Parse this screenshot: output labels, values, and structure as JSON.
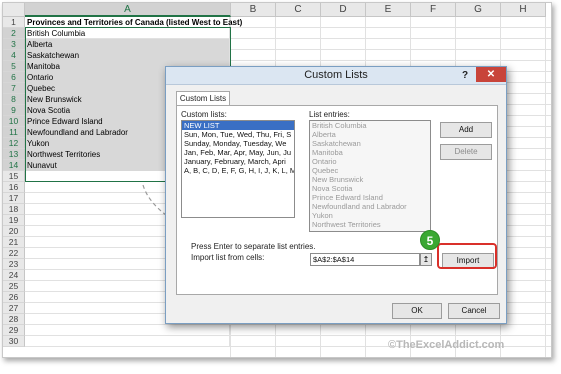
{
  "sheet": {
    "columns": [
      "A",
      "B",
      "C",
      "D",
      "E",
      "F",
      "G",
      "H"
    ],
    "rows": [
      {
        "num": "1",
        "a": "Provinces and Territories of Canada (listed West to East)"
      },
      {
        "num": "2",
        "a": "British Columbia"
      },
      {
        "num": "3",
        "a": "Alberta"
      },
      {
        "num": "4",
        "a": "Saskatchewan"
      },
      {
        "num": "5",
        "a": "Manitoba"
      },
      {
        "num": "6",
        "a": "Ontario"
      },
      {
        "num": "7",
        "a": "Quebec"
      },
      {
        "num": "8",
        "a": "New Brunswick"
      },
      {
        "num": "9",
        "a": "Nova Scotia"
      },
      {
        "num": "10",
        "a": "Prince Edward Island"
      },
      {
        "num": "11",
        "a": "Newfoundland and Labrador"
      },
      {
        "num": "12",
        "a": "Yukon"
      },
      {
        "num": "13",
        "a": "Northwest Territories"
      },
      {
        "num": "14",
        "a": "Nunavut"
      },
      {
        "num": "15",
        "a": ""
      },
      {
        "num": "16",
        "a": ""
      },
      {
        "num": "17",
        "a": ""
      },
      {
        "num": "18",
        "a": ""
      },
      {
        "num": "19",
        "a": ""
      },
      {
        "num": "20",
        "a": ""
      },
      {
        "num": "21",
        "a": ""
      },
      {
        "num": "22",
        "a": ""
      },
      {
        "num": "23",
        "a": ""
      },
      {
        "num": "24",
        "a": ""
      },
      {
        "num": "25",
        "a": ""
      },
      {
        "num": "26",
        "a": ""
      },
      {
        "num": "27",
        "a": ""
      },
      {
        "num": "28",
        "a": ""
      },
      {
        "num": "29",
        "a": ""
      },
      {
        "num": "30",
        "a": ""
      }
    ]
  },
  "dialog": {
    "title": "Custom Lists",
    "help": "?",
    "close": "✕",
    "tab": "Custom Lists",
    "custom_lists_label": "Custom lists:",
    "custom_lists": [
      "NEW LIST",
      "Sun, Mon, Tue, Wed, Thu, Fri, S",
      "Sunday, Monday, Tuesday, We",
      "Jan, Feb, Mar, Apr, May, Jun, Ju",
      "January, February, March, Apri",
      "A, B, C, D, E, F, G, H, I, J, K, L, M"
    ],
    "list_entries_label": "List entries:",
    "list_entries": [
      "British Columbia",
      "Alberta",
      "Saskatchewan",
      "Manitoba",
      "Ontario",
      "Quebec",
      "New Brunswick",
      "Nova Scotia",
      "Prince Edward Island",
      "Newfoundland and Labrador",
      "Yukon",
      "Northwest Territories"
    ],
    "add": "Add",
    "delete": "Delete",
    "hint": "Press Enter to separate list entries.",
    "import_label": "Import list from cells:",
    "import_value": "$A$2:$A$14",
    "collapse_icon": "↥",
    "import": "Import",
    "ok": "OK",
    "cancel": "Cancel"
  },
  "step_badge": "5",
  "watermark": "©TheExcelAddict.com"
}
